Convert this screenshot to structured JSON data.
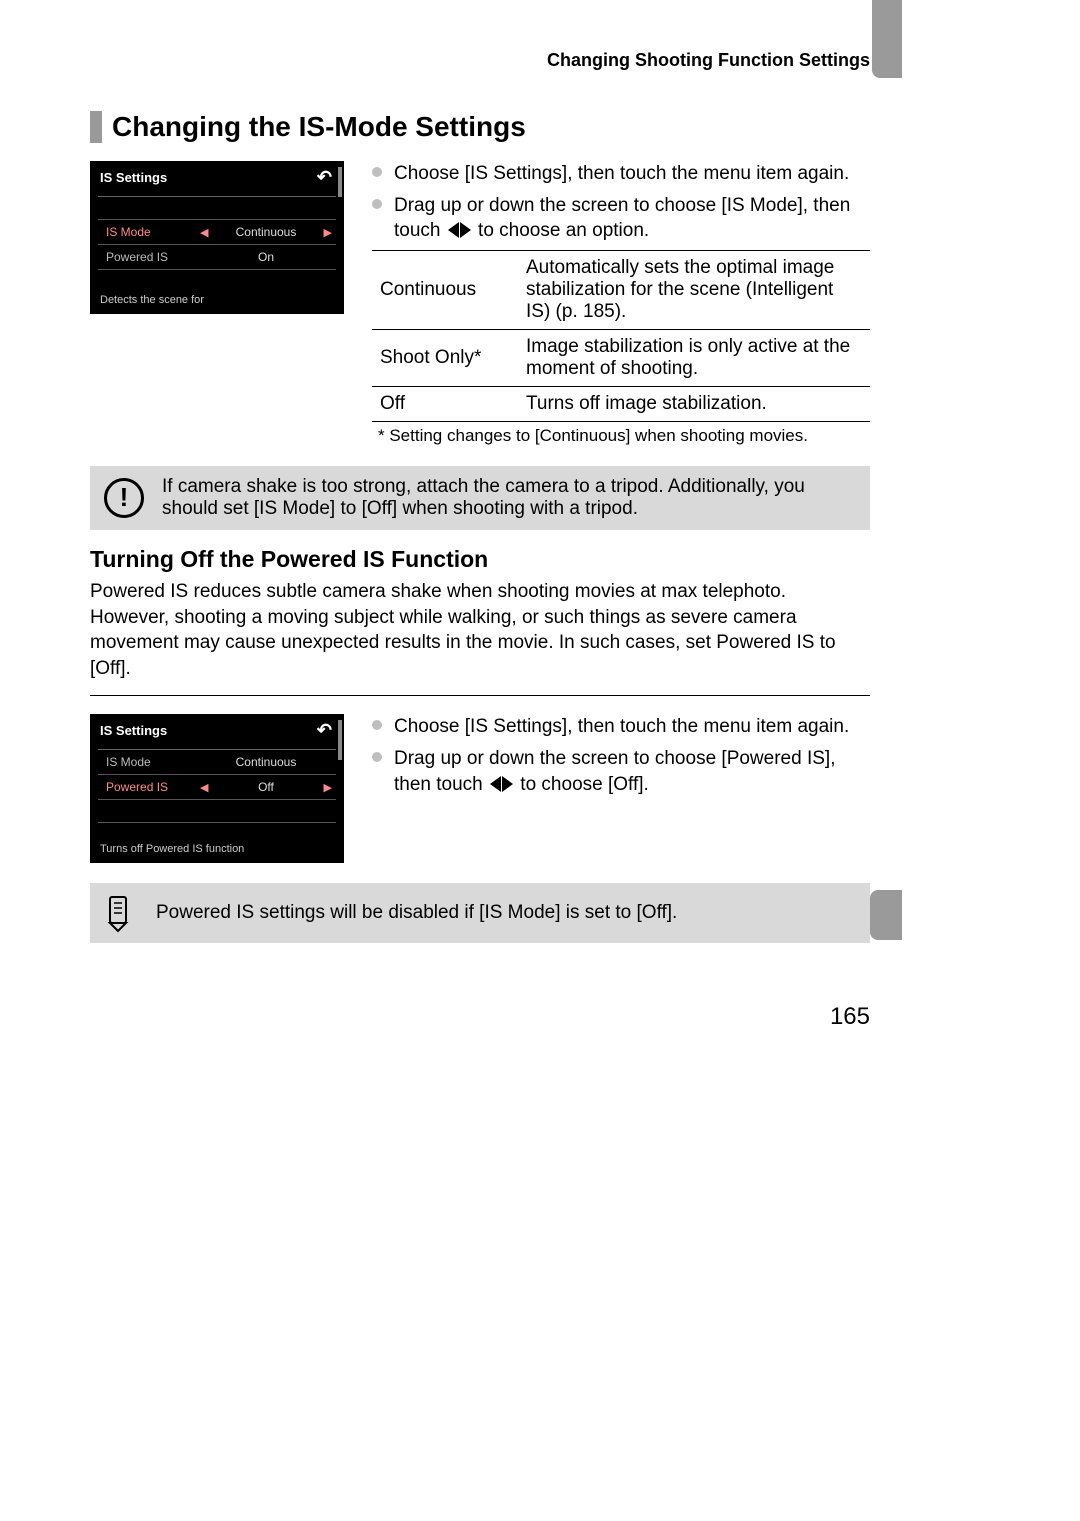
{
  "running_head": "Changing Shooting Function Settings",
  "section_title": "Changing the IS-Mode Settings",
  "screenshot1": {
    "title": "IS Settings",
    "rows": [
      {
        "label": "IS Mode",
        "value": "Continuous",
        "highlight": true
      },
      {
        "label": "Powered IS",
        "value": "On",
        "highlight": false
      }
    ],
    "desc": "Detects the scene for"
  },
  "bullets1": {
    "b1a": "Choose [IS Settings], then touch the menu item again.",
    "b1b_pre": "Drag up or down the screen to choose [IS Mode], then touch ",
    "b1b_post": " to choose an option."
  },
  "table": {
    "rows": [
      {
        "opt": "Continuous",
        "desc": "Automatically sets the optimal image stabilization for the scene (Intelligent IS) (p. 185)."
      },
      {
        "opt": "Shoot Only*",
        "desc": "Image stabilization is only active at the moment of shooting."
      },
      {
        "opt": "Off",
        "desc": "Turns off image stabilization."
      }
    ],
    "note": "* Setting changes to [Continuous] when shooting movies."
  },
  "callout1": "If camera shake is too strong, attach the camera to a tripod. Additionally, you should set [IS Mode] to [Off] when shooting with a tripod.",
  "sub_title": "Turning Off the Powered IS Function",
  "sub_body": "Powered IS reduces subtle camera shake when shooting movies at max telephoto. However, shooting a moving subject while walking, or such things as severe camera movement may cause unexpected results in the movie. In such cases, set Powered IS to [Off].",
  "screenshot2": {
    "title": "IS Settings",
    "rows": [
      {
        "label": "IS Mode",
        "value": "Continuous",
        "highlight": false
      },
      {
        "label": "Powered IS",
        "value": "Off",
        "highlight": true
      }
    ],
    "desc": "Turns off Powered IS function"
  },
  "bullets2": {
    "b2a": "Choose [IS Settings], then touch the menu item again.",
    "b2b_pre": "Drag up or down the screen to choose [Powered IS], then touch ",
    "b2b_post": " to choose [Off]."
  },
  "callout2": "Powered IS settings will be disabled if [IS Mode] is set to [Off].",
  "page_number": "165"
}
